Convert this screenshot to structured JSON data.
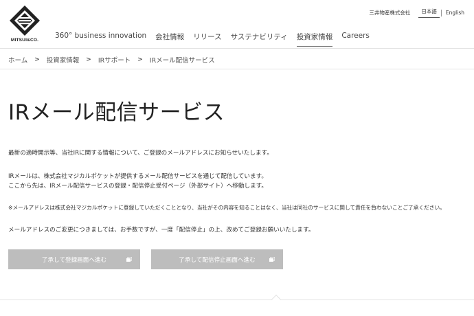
{
  "header": {
    "logo_text": "MITSUI&CO.",
    "corporate_name": "三井物産株式会社",
    "languages": [
      {
        "label": "日本語",
        "active": true
      },
      {
        "label": "English",
        "active": false
      }
    ],
    "nav": [
      {
        "label": "360° business innovation",
        "active": false
      },
      {
        "label": "会社情報",
        "active": false
      },
      {
        "label": "リリース",
        "active": false
      },
      {
        "label": "サステナビリティ",
        "active": false
      },
      {
        "label": "投資家情報",
        "active": true
      },
      {
        "label": "Careers",
        "active": false
      }
    ]
  },
  "breadcrumb": [
    "ホーム",
    "投資家情報",
    "IRサポート",
    "IRメール配信サービス"
  ],
  "page": {
    "title": "IRメール配信サービス",
    "para1": "最新の適時開示等、当社IRに関する情報について、ご登録のメールアドレスにお知らせいたします。",
    "para2_line1": "IRメールは、株式会社マジカルポケットが提供するメール配信サービスを通じて配信しています。",
    "para2_line2": "ここから先は、IRメール配信サービスの登録・配信停止受付ページ（外部サイト）へ移動します。",
    "note": "※メールアドレスは株式会社マジカルポケットに登録していただくこととなり、当社がその内容を知ることはなく、当社は同社のサービスに関して責任を負わないことご了承ください。",
    "para3": "メールアドレスのご変更につきましては、お手数ですが、一度「配信停止」の上、改めてご登録お願いいたします。"
  },
  "buttons": {
    "register": "了承して登録画面へ進む",
    "unsubscribe": "了承して配信停止画面へ進む"
  },
  "colors": {
    "button_bg": "#bdbdbd",
    "divider": "#e3e3e3"
  }
}
